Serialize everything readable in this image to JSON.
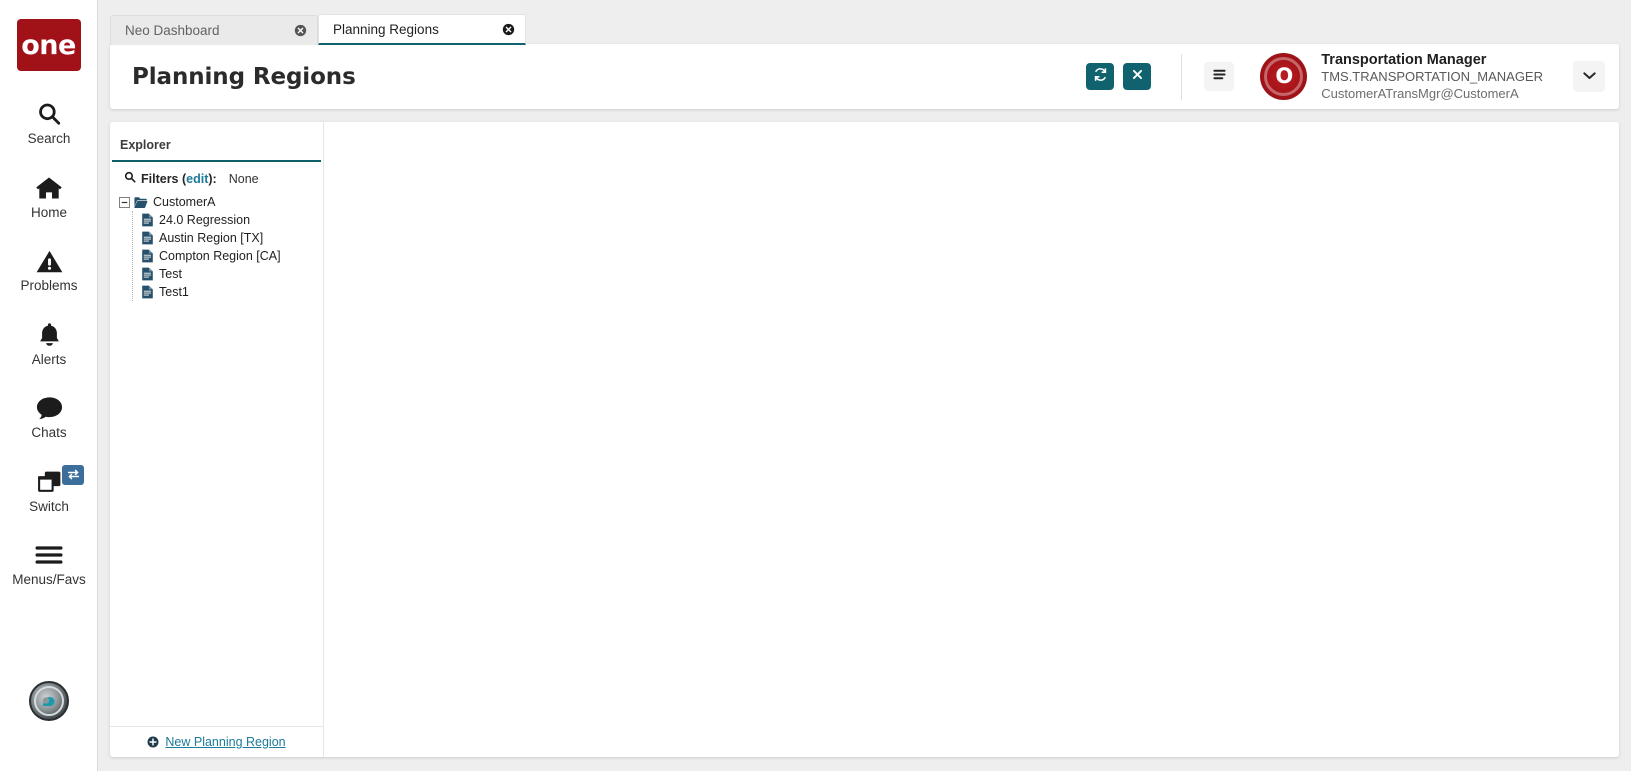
{
  "brand": {
    "logo_text": "one",
    "logo_color": "#a01217",
    "accent_teal": "#10626e",
    "link_blue": "#1b7b99"
  },
  "rail": {
    "items": [
      {
        "label": "Search",
        "icon": "search-icon"
      },
      {
        "label": "Home",
        "icon": "home-icon"
      },
      {
        "label": "Problems",
        "icon": "warning-triangle-icon"
      },
      {
        "label": "Alerts",
        "icon": "bell-icon"
      },
      {
        "label": "Chats",
        "icon": "chat-bubble-icon"
      },
      {
        "label": "Switch",
        "icon": "windows-stack-icon",
        "badge_icon": "swap-arrows-icon"
      },
      {
        "label": "Menus/Favs",
        "icon": "hamburger-icon"
      }
    ],
    "assistant_avatar": "assistant-avatar-icon"
  },
  "tabs": [
    {
      "label": "Neo Dashboard",
      "active": false,
      "close_icon": "close-circle-icon"
    },
    {
      "label": "Planning Regions",
      "active": true,
      "close_icon": "close-circle-icon"
    }
  ],
  "header": {
    "title": "Planning Regions",
    "refresh_icon": "refresh-icon",
    "close_icon": "close-x-icon",
    "menu_icon": "hamburger-menu-icon",
    "caret_icon": "chevron-down-icon",
    "user": {
      "avatar_text": "O",
      "name": "Transportation Manager",
      "role": "TMS.TRANSPORTATION_MANAGER",
      "email": "CustomerATransMgr@CustomerA"
    }
  },
  "explorer": {
    "tab_label": "Explorer",
    "filters": {
      "search_icon": "search-icon",
      "label": "Filters (",
      "edit_label": "edit",
      "label_end": "):",
      "value": "None"
    },
    "tree": {
      "root": {
        "label": "CustomerA",
        "icon": "open-folder-icon",
        "toggle_icon": "collapse-box-icon",
        "expanded": true
      },
      "children": [
        {
          "label": "24.0 Regression",
          "icon": "document-icon"
        },
        {
          "label": "Austin Region [TX]",
          "icon": "document-icon"
        },
        {
          "label": "Compton Region [CA]",
          "icon": "document-icon"
        },
        {
          "label": "Test",
          "icon": "document-icon"
        },
        {
          "label": "Test1",
          "icon": "document-icon"
        }
      ]
    },
    "footer": {
      "add_icon": "plus-circle-icon",
      "new_label": "New Planning Region"
    }
  }
}
